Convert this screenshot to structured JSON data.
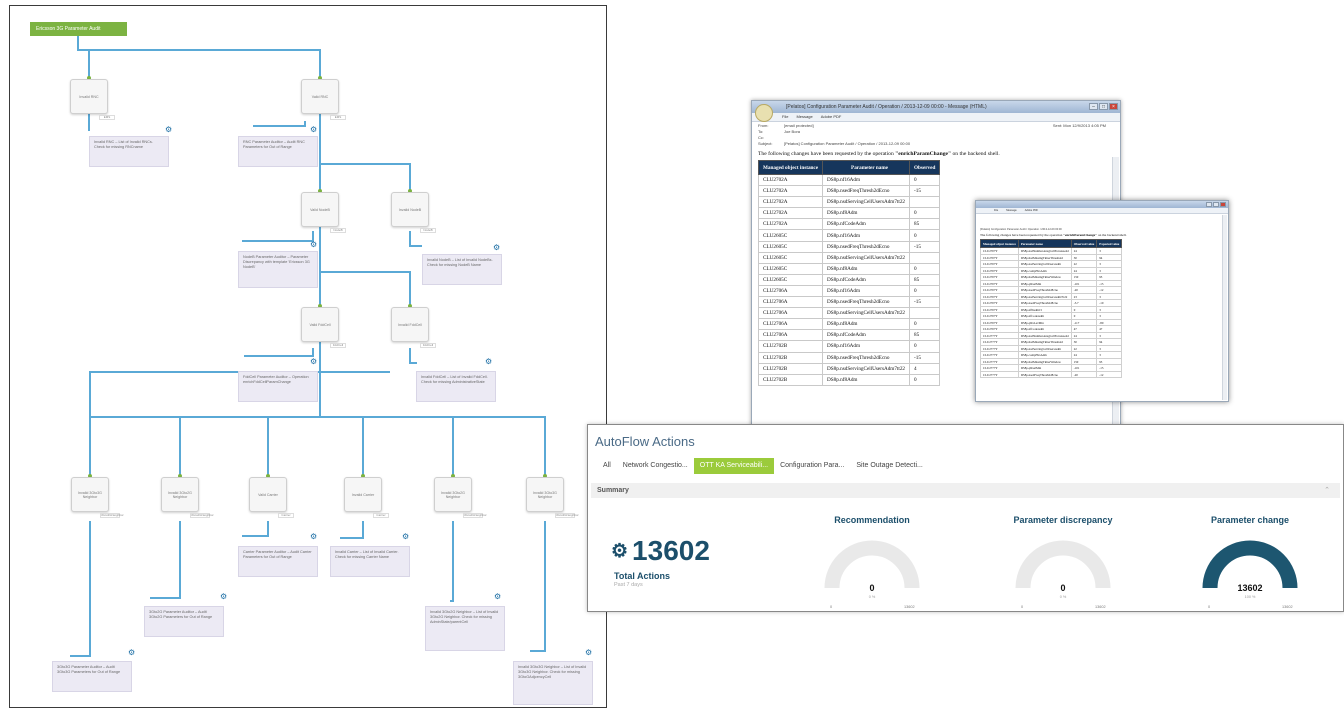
{
  "workflow": {
    "start_label": "Ericsson 3G Parameter Audit",
    "nodes": [
      "Invalid RNC",
      "Valid RNC",
      "Valid NodeB",
      "Invalid NodeB",
      "Valid FddCell",
      "Invalid FddCell",
      "Invalid 3Gto3G Neighbor",
      "Invalid 3Gto2G Neighbor",
      "Valid Carrier",
      "Invalid Carrier",
      "Invalid 3Gto2G Neighbor",
      "Invalid 3Gto3G Neighbor"
    ],
    "ports": [
      "EMS",
      "EMS",
      "NodeB",
      "NodeB",
      "FddCell",
      "FddCell",
      "3Gto3GNeighbor",
      "3Gto2GNeighbor",
      "Carrier",
      "Carrier",
      "3Gto2GNeighbor",
      "3Gto3GNeighbor"
    ],
    "actions": [
      "Invalid RNC – List of Invalid RNCs. Check for missing RNCname",
      "RNC Parameter Auditor – Audit RNC Parameters for Out of Range",
      "NodeB Parameter Auditor – Parameter Discrepancy with template 'Ericsson 3G NodeB'",
      "Invalid NodeB – List of Invalid NodeBs. Check for missing NodeB Name",
      "FddCell Parameter Auditor – Operation enrichFddCellParamChange",
      "Invalid FddCell – List of Invalid FddCell. Check for missing AdministrativeState",
      "Carrier Parameter Auditor – Audit Carrier Parameters for Out of Range",
      "Invalid Carrier – List of Invalid Carrier. Check for missing Carrier Name",
      "3Gto2G Parameter Auditor – Audit 3Gto2G Parameters for Out of Range",
      "Invalid 3Gto2G Neighbor – List of Invalid 3Gto2G Neighbor. Check for missing AdminState/parentCell",
      "3Gto3G Parameter Auditor – Audit 3Gto3G Parameters for Out of Range",
      "Invalid 3Gto3G Neighbor – List of Invalid 3Gto3G Neighbor. Check for missing 3GtoGAdjcencyCell"
    ]
  },
  "mail1": {
    "title": "[Pelatos] Configuration Parameter Audit / Operation / 2013-12-09 00:00 - Message (HTML)",
    "ribbon": [
      "File",
      "Message",
      "Adobe PDF"
    ],
    "from_label": "From:",
    "from": "[email protected]",
    "to_label": "To:",
    "to": "Joe Bora",
    "cc_label": "Cc:",
    "cc": "",
    "subject_label": "Subject:",
    "subject": "[Pelatos] Configuration Parameter Audit / Operation / 2013-12-09 00:00",
    "sent_label": "Sent:",
    "sent": "Mon 12/9/2013 4:05 PM",
    "intro_pre": "The following changes have been requested by the operation ",
    "intro_op": "\"enrichParamChange\"",
    "intro_post": " on the backend shell.",
    "columns": [
      "Managed object instance",
      "Parameter name",
      "Observed"
    ],
    "rows": [
      [
        "CLU2702A",
        "DS8p.nf16Adm",
        "0"
      ],
      [
        "CLU2702A",
        "DS8p.nsedFreqThresh2dEcno",
        "-15"
      ],
      [
        "CLU2702A",
        "DS8p.nsdServingCellUsersAdm7tt22",
        ""
      ],
      [
        "CLU2702A",
        "DS8p.nf8Adm",
        "0"
      ],
      [
        "CLU2702A",
        "DS8p.nfCodeAdm",
        "85"
      ],
      [
        "CLU2605C",
        "DS8p.nf16Adm",
        "0"
      ],
      [
        "CLU2605C",
        "DS8p.nsedFreqThresh2dEcno",
        "-15"
      ],
      [
        "CLU2605C",
        "DS8p.nsdServingCellUsersAdm7tt22",
        ""
      ],
      [
        "CLU2605C",
        "DS8p.nf8Adm",
        "0"
      ],
      [
        "CLU2605C",
        "DS8p.nfCodeAdm",
        "85"
      ],
      [
        "CLU2706A",
        "DS8p.nf16Adm",
        "0"
      ],
      [
        "CLU2706A",
        "DS8p.nsedFreqThresh2dEcno",
        "-15"
      ],
      [
        "CLU2706A",
        "DS8p.nsdServingCellUsersAdm7tt22",
        ""
      ],
      [
        "CLU2706A",
        "DS8p.nf8Adm",
        "0"
      ],
      [
        "CLU2706A",
        "DS8p.nfCodeAdm",
        "85"
      ],
      [
        "CLU2702B",
        "DS8p.nf16Adm",
        "0"
      ],
      [
        "CLU2702B",
        "DS8p.nsedFreqThresh2dEcno",
        "-15"
      ],
      [
        "CLU2702B",
        "DS8p.nsdServingCellUsersAdm7tt22",
        "4"
      ],
      [
        "CLU2702B",
        "DS8p.nf8Adm",
        "0"
      ]
    ]
  },
  "mail2": {
    "ribbon": [
      "File",
      "Message",
      "Adobe PDF"
    ],
    "subject": "[Pelatos] Configuration Parameter Audit / Operation / 2013-12-09 00:00",
    "intro_pre": "The following changes have been requested by the operation ",
    "intro_op": "\"enrichParamChange\"",
    "intro_post": " on the backend shell.",
    "columns": [
      "Managed object instance",
      "Parameter name",
      "Observed value",
      "Expected value"
    ],
    "rows": [
      [
        "CLU2707Y",
        "DS8p.nsdNumberAnsgCellForreuse4d",
        "24",
        "3"
      ],
      [
        "CLU2707Y",
        "DS8p.hsdMissingTimerThreshold",
        "30",
        "94"
      ],
      [
        "CLU2707Y",
        "DS8p.nsdServingCellUsersAdm",
        "22",
        "3"
      ],
      [
        "CLU2707Y",
        "DS8p.compHvsAdm",
        "24",
        "3"
      ],
      [
        "CLU2707Y",
        "DS8p.hsdMissingTimerWindow",
        "150",
        "95"
      ],
      [
        "CLU2707Y",
        "DS8p.qRxelMin",
        "-101",
        "-15"
      ],
      [
        "CLU2707Y",
        "DS8p.nsedFreqThresh2dEcno",
        "-20",
        "-12"
      ],
      [
        "CLU2707Y",
        "DS8p.nsdServingCellUsersAdm7tt22",
        "23",
        "3"
      ],
      [
        "CLU2707Y",
        "DS8p.nsedFreqThresh2dEcno",
        "-3.7",
        "-10"
      ],
      [
        "CLU2707Y",
        "DS8p.nf8Adm15",
        "0",
        "3"
      ],
      [
        "CLU2707Y",
        "DS8p.nfCodeAdm",
        "0",
        "3"
      ],
      [
        "CLU2707Y",
        "DS8p.qRxLevMin",
        "-117",
        "-80"
      ],
      [
        "CLU2707Y",
        "DS8p.nfCodeAdm",
        "47",
        "47"
      ],
      [
        "CLU2777Y",
        "DS8p.nsdNumberAnsgCellForreuse4d",
        "24",
        "3"
      ],
      [
        "CLU2777Y",
        "DS8p.hsdMissingTimerThreshold",
        "30",
        "94"
      ],
      [
        "CLU2777Y",
        "DS8p.nsdServingCellUsersAdm",
        "22",
        "3"
      ],
      [
        "CLU2777Y",
        "DS8p.compHvsAdm",
        "24",
        "3"
      ],
      [
        "CLU2777Y",
        "DS8p.hsdMissingTimerWindow",
        "150",
        "95"
      ],
      [
        "CLU2777Y",
        "DS8p.qRxelMin",
        "-101",
        "-15"
      ],
      [
        "CLU2777Y",
        "DS8p.nsedFreqThresh2dEcno",
        "-20",
        "-12"
      ]
    ]
  },
  "autoflow": {
    "title": "AutoFlow Actions",
    "tabs": [
      "All",
      "Network Congestio...",
      "OTT KA Serviceabili...",
      "Configuration Para...",
      "Site Outage Detecti..."
    ],
    "active_tab": 2,
    "summary_label": "Summary",
    "total_value": "13602",
    "total_label": "Total Actions",
    "total_sub": "Past 7 days",
    "gauges": [
      {
        "title": "Recommendation",
        "value": "0",
        "pct": "0 %",
        "min": "0",
        "max": "13602",
        "fraction": 0
      },
      {
        "title": "Parameter discrepancy",
        "value": "0",
        "pct": "0 %",
        "min": "0",
        "max": "13602",
        "fraction": 0
      },
      {
        "title": "Parameter change",
        "value": "13602",
        "pct": "100 %",
        "min": "0",
        "max": "13602",
        "fraction": 1
      }
    ],
    "colors": {
      "active_tab": "#9bcb3b",
      "gauge_fill": "#1d5670",
      "gauge_track": "#e9e9e9",
      "title": "#4a6a86"
    }
  }
}
